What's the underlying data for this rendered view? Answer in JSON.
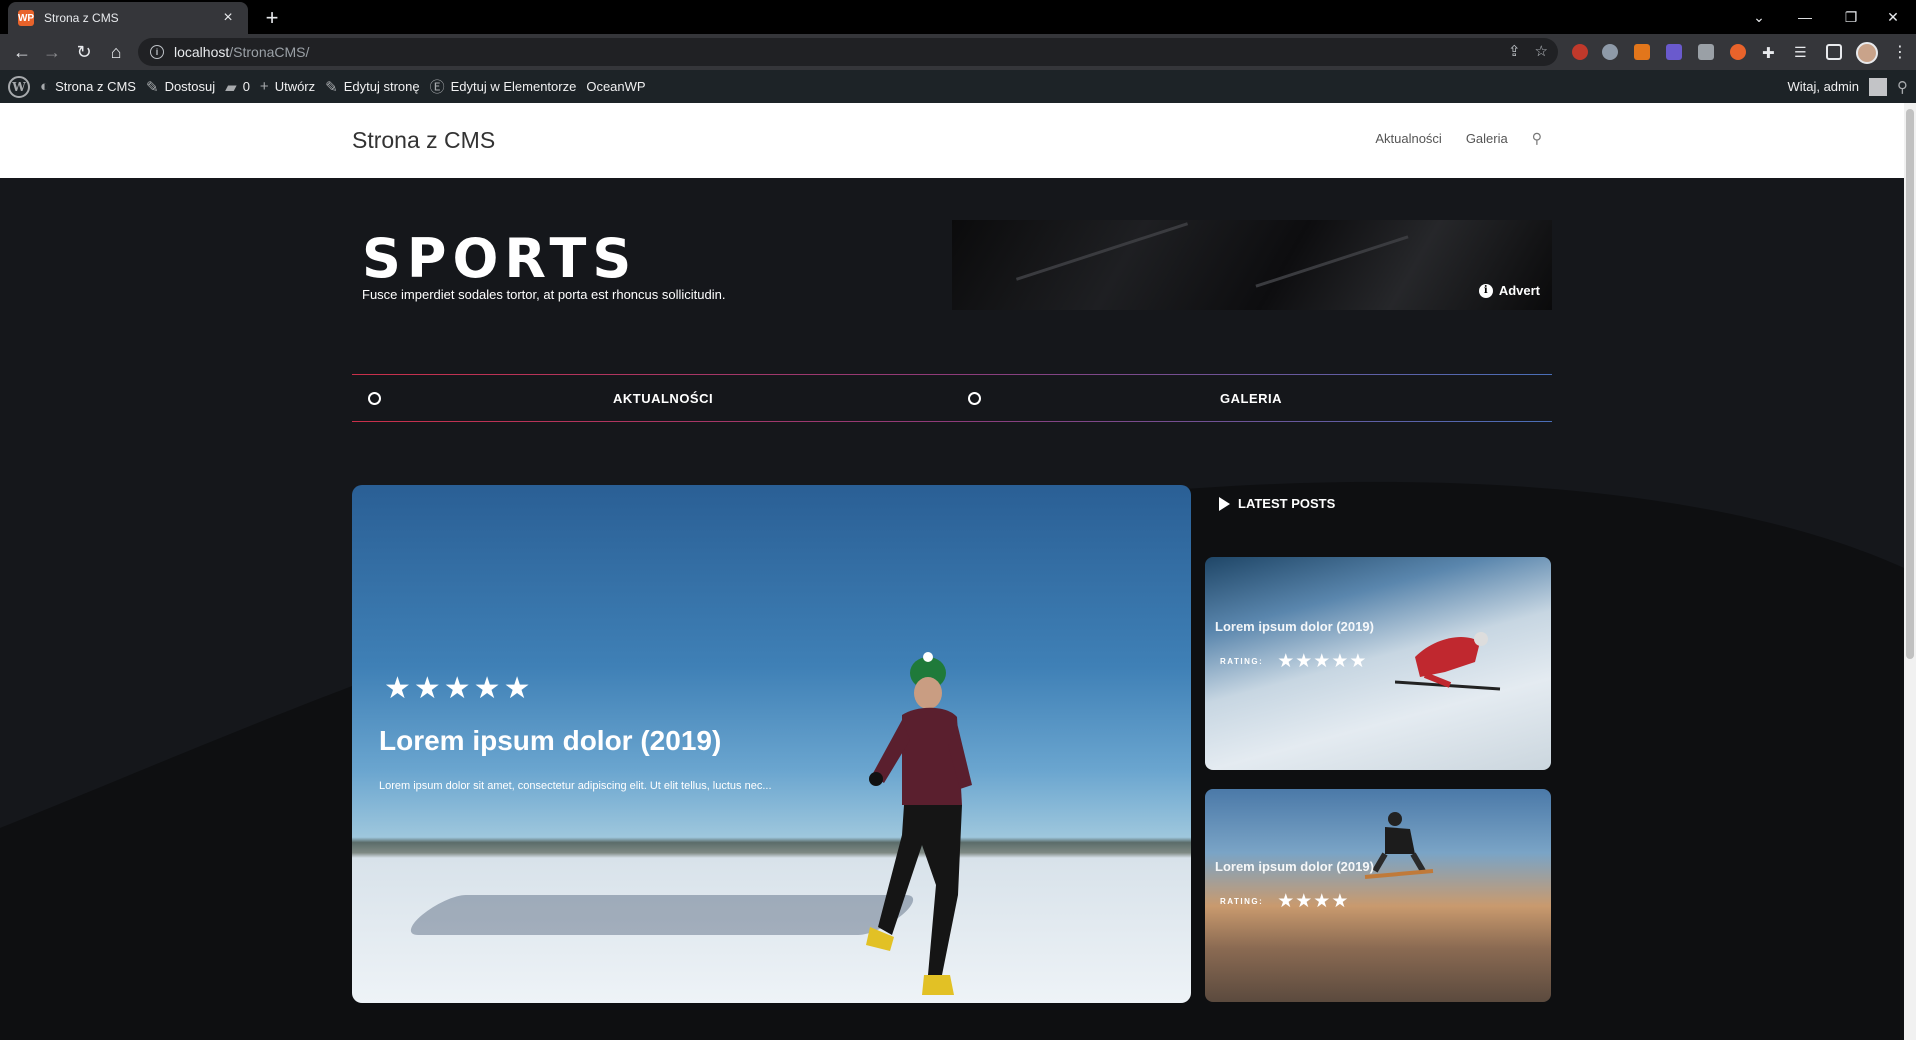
{
  "browser": {
    "tab_title": "Strona z CMS",
    "tab_favicon": "WP",
    "tab_close": "×",
    "new_tab": "+",
    "url_host": "localhost",
    "url_path": "/StronaCMS/",
    "win_minimize": "—",
    "win_restore": "❐",
    "win_close": "✕",
    "win_tabsearch": "⌄",
    "back": "←",
    "forward": "→",
    "reload": "↻",
    "home": "⌂",
    "menu": "⋮"
  },
  "adminbar": {
    "items": [
      {
        "label": "Strona z CMS",
        "icon": "dashboard-icon",
        "glyph": "◐"
      },
      {
        "label": "Dostosuj",
        "icon": "brush-icon",
        "glyph": "✎"
      },
      {
        "label": "0",
        "icon": "comment-icon",
        "glyph": "▰"
      },
      {
        "label": "Utwórz",
        "icon": "plus-icon",
        "glyph": "+"
      },
      {
        "label": "Edytuj stronę",
        "icon": "pencil-icon",
        "glyph": "✎"
      },
      {
        "label": "Edytuj w Elementorze",
        "icon": "elementor-icon",
        "glyph": "Ⓔ"
      },
      {
        "label": "OceanWP",
        "icon": "",
        "glyph": ""
      }
    ],
    "greeting": "Witaj, admin",
    "search_glyph": "⚲"
  },
  "site": {
    "title": "Strona z CMS",
    "nav": [
      "Aktualności",
      "Galeria"
    ],
    "search_glyph": "⚲"
  },
  "hero_section": {
    "title": "SPORTS",
    "subtitle": "Fusce imperdiet sodales tortor, at porta est rhoncus sollicitudin.",
    "advert_label": "Advert",
    "advert_info": "i"
  },
  "categories": [
    "AKTUALNOŚCI",
    "GALERIA"
  ],
  "featured_post": {
    "stars": "★★★★★",
    "rating": 5,
    "title": "Lorem ipsum dolor (2019)",
    "excerpt": "Lorem ipsum dolor sit amet, consectetur adipiscing elit. Ut elit tellus, luctus nec..."
  },
  "sidebar": {
    "heading": "LATEST POSTS",
    "posts": [
      {
        "title": "Lorem ipsum dolor (2019)",
        "rating_label": "RATING:",
        "stars": "★★★★★",
        "rating": 5
      },
      {
        "title": "Lorem ipsum dolor (2019)",
        "rating_label": "RATING:",
        "stars": "★★★★",
        "rating": 4
      }
    ]
  },
  "colors": {
    "page_bg": "#15171b",
    "wave": "#0e0f11",
    "cat_line_start": "#c9304a",
    "cat_line_end": "#4a6fb8"
  }
}
